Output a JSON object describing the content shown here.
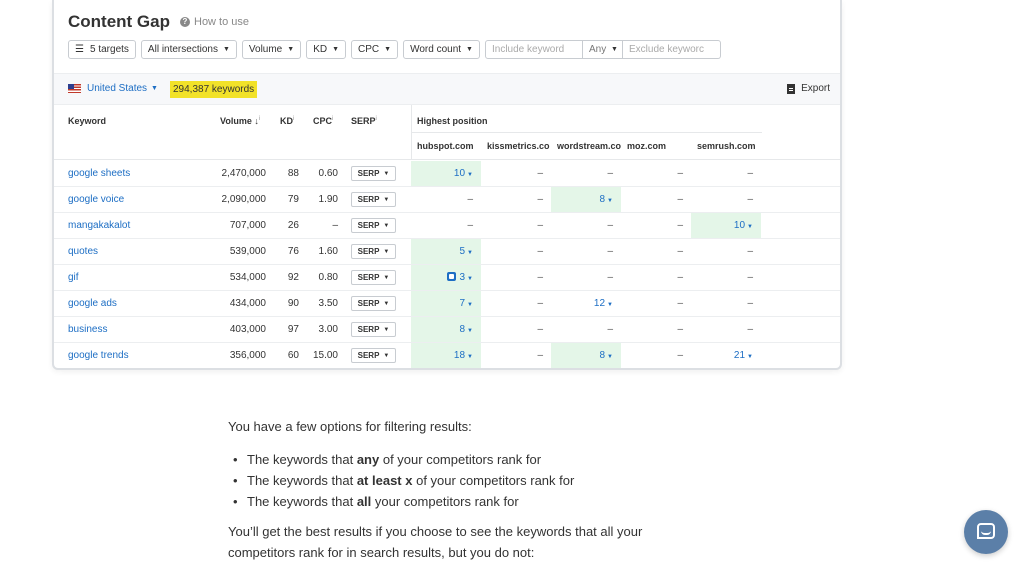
{
  "panel": {
    "title": "Content Gap",
    "help_label": "How to use",
    "filters": {
      "targets": "5 targets",
      "intersections": "All intersections",
      "volume": "Volume",
      "kd": "KD",
      "cpc": "CPC",
      "word_count": "Word count",
      "include_placeholder": "Include keyword",
      "any_label": "Any",
      "exclude_placeholder": "Exclude keyworc"
    },
    "toolbar": {
      "country": "United States",
      "keywords_count": "294,387 keywords",
      "export_label": "Export"
    },
    "columns": {
      "keyword": "Keyword",
      "volume": "Volume ↓",
      "kd": "KD",
      "cpc": "CPC",
      "serp": "SERP",
      "highest_position": "Highest position",
      "info_mark": "i"
    },
    "competitors": [
      "hubspot.com",
      "kissmetrics.co",
      "wordstream.co",
      "moz.com",
      "semrush.com"
    ],
    "serp_label": "SERP",
    "rows": [
      {
        "keyword": "google sheets",
        "volume": "2,470,000",
        "kd": "88",
        "cpc": "0.60",
        "positions": [
          "10",
          "–",
          "–",
          "–",
          "–"
        ]
      },
      {
        "keyword": "google voice",
        "volume": "2,090,000",
        "kd": "79",
        "cpc": "1.90",
        "positions": [
          "–",
          "–",
          "8",
          "–",
          "–"
        ]
      },
      {
        "keyword": "mangakakalot",
        "volume": "707,000",
        "kd": "26",
        "cpc": "–",
        "positions": [
          "–",
          "–",
          "–",
          "–",
          "10"
        ]
      },
      {
        "keyword": "quotes",
        "volume": "539,000",
        "kd": "76",
        "cpc": "1.60",
        "positions": [
          "5",
          "–",
          "–",
          "–",
          "–"
        ]
      },
      {
        "keyword": "gif",
        "volume": "534,000",
        "kd": "92",
        "cpc": "0.80",
        "positions": [
          "3",
          "–",
          "–",
          "–",
          "–"
        ]
      },
      {
        "keyword": "google ads",
        "volume": "434,000",
        "kd": "90",
        "cpc": "3.50",
        "positions": [
          "7",
          "–",
          "12",
          "–",
          "–"
        ]
      },
      {
        "keyword": "business",
        "volume": "403,000",
        "kd": "97",
        "cpc": "3.00",
        "positions": [
          "8",
          "–",
          "–",
          "–",
          "–"
        ]
      },
      {
        "keyword": "google trends",
        "volume": "356,000",
        "kd": "60",
        "cpc": "15.00",
        "positions": [
          "18",
          "–",
          "8",
          "–",
          "21"
        ]
      }
    ]
  },
  "article": {
    "intro": "You have a few options for filtering results:",
    "bullets": [
      {
        "pre": "The keywords that ",
        "bold": "any",
        "post": " of your competitors rank for"
      },
      {
        "pre": "The keywords that ",
        "bold": "at least x",
        "post": " of your competitors rank for"
      },
      {
        "pre": "The keywords that ",
        "bold": "all",
        "post": " your competitors rank for"
      }
    ],
    "p2_line1": "You’ll get the best results if you choose to see the keywords that all your",
    "p2_line2": "competitors rank for in search results, but you do not:"
  },
  "colors": {
    "link": "#1d6ec4",
    "highlight": "#f2e229",
    "best_position": "#e4f6e8",
    "chat": "#5b7fa8"
  }
}
